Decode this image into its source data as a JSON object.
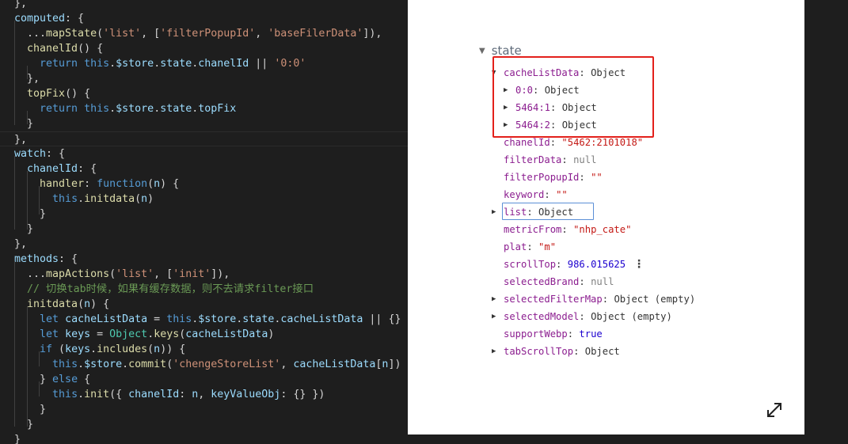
{
  "editor": {
    "lines": [
      [
        [
          "t-pl",
          "},"
        ]
      ],
      [
        [
          "t-var",
          "computed"
        ],
        [
          "t-pl",
          ": {"
        ]
      ],
      [
        [
          "t-pl",
          "  ..."
        ],
        [
          "t-fn",
          "mapState"
        ],
        [
          "t-pl",
          "("
        ],
        [
          "t-str",
          "'list'"
        ],
        [
          "t-pl",
          ", ["
        ],
        [
          "t-str",
          "'filterPopupId'"
        ],
        [
          "t-pl",
          ", "
        ],
        [
          "t-str",
          "'baseFilerData'"
        ],
        [
          "t-pl",
          "]),"
        ]
      ],
      [
        [
          "t-pl",
          "  "
        ],
        [
          "t-fn",
          "chanelId"
        ],
        [
          "t-pl",
          "() {"
        ]
      ],
      [
        [
          "t-pl",
          "    "
        ],
        [
          "t-kw",
          "return"
        ],
        [
          "t-pl",
          " "
        ],
        [
          "t-kw",
          "this"
        ],
        [
          "t-pl",
          "."
        ],
        [
          "t-var",
          "$store"
        ],
        [
          "t-pl",
          "."
        ],
        [
          "t-var",
          "state"
        ],
        [
          "t-pl",
          "."
        ],
        [
          "t-var",
          "chanelId"
        ],
        [
          "t-pl",
          " || "
        ],
        [
          "t-str",
          "'0:0'"
        ]
      ],
      [
        [
          "t-pl",
          "  },"
        ]
      ],
      [
        [
          "t-pl",
          "  "
        ],
        [
          "t-fn",
          "topFix"
        ],
        [
          "t-pl",
          "() {"
        ]
      ],
      [
        [
          "t-pl",
          "    "
        ],
        [
          "t-kw",
          "return"
        ],
        [
          "t-pl",
          " "
        ],
        [
          "t-kw",
          "this"
        ],
        [
          "t-pl",
          "."
        ],
        [
          "t-var",
          "$store"
        ],
        [
          "t-pl",
          "."
        ],
        [
          "t-var",
          "state"
        ],
        [
          "t-pl",
          "."
        ],
        [
          "t-var",
          "topFix"
        ]
      ],
      [
        [
          "t-pl",
          "  }"
        ]
      ],
      [
        [
          "t-pl",
          "},"
        ]
      ],
      [
        [
          "t-var",
          "watch"
        ],
        [
          "t-pl",
          ": {"
        ]
      ],
      [
        [
          "t-pl",
          "  "
        ],
        [
          "t-var",
          "chanelId"
        ],
        [
          "t-pl",
          ": {"
        ]
      ],
      [
        [
          "t-pl",
          "    "
        ],
        [
          "t-fn",
          "handler"
        ],
        [
          "t-pl",
          ": "
        ],
        [
          "t-kw",
          "function"
        ],
        [
          "t-pl",
          "("
        ],
        [
          "t-var",
          "n"
        ],
        [
          "t-pl",
          ") {"
        ]
      ],
      [
        [
          "t-pl",
          "      "
        ],
        [
          "t-kw",
          "this"
        ],
        [
          "t-pl",
          "."
        ],
        [
          "t-fn",
          "initdata"
        ],
        [
          "t-pl",
          "("
        ],
        [
          "t-var",
          "n"
        ],
        [
          "t-pl",
          ")"
        ]
      ],
      [
        [
          "t-pl",
          "    }"
        ]
      ],
      [
        [
          "t-pl",
          "  }"
        ]
      ],
      [
        [
          "t-pl",
          "},"
        ]
      ],
      [
        [
          "t-var",
          "methods"
        ],
        [
          "t-pl",
          ": {"
        ]
      ],
      [
        [
          "t-pl",
          "  ..."
        ],
        [
          "t-fn",
          "mapActions"
        ],
        [
          "t-pl",
          "("
        ],
        [
          "t-str",
          "'list'"
        ],
        [
          "t-pl",
          ", ["
        ],
        [
          "t-str",
          "'init'"
        ],
        [
          "t-pl",
          "]),"
        ]
      ],
      [
        [
          "t-cmt",
          "  // 切换tab时候，如果有缓存数据，则不去请求filter接口"
        ]
      ],
      [
        [
          "t-pl",
          "  "
        ],
        [
          "t-fn",
          "initdata"
        ],
        [
          "t-pl",
          "("
        ],
        [
          "t-var",
          "n"
        ],
        [
          "t-pl",
          ") {"
        ]
      ],
      [
        [
          "t-pl",
          "    "
        ],
        [
          "t-kw",
          "let"
        ],
        [
          "t-pl",
          " "
        ],
        [
          "t-var",
          "cacheListData"
        ],
        [
          "t-pl",
          " = "
        ],
        [
          "t-kw",
          "this"
        ],
        [
          "t-pl",
          "."
        ],
        [
          "t-var",
          "$store"
        ],
        [
          "t-pl",
          "."
        ],
        [
          "t-var",
          "state"
        ],
        [
          "t-pl",
          "."
        ],
        [
          "t-var",
          "cacheListData"
        ],
        [
          "t-pl",
          " || {}"
        ]
      ],
      [
        [
          "t-pl",
          "    "
        ],
        [
          "t-kw",
          "let"
        ],
        [
          "t-pl",
          " "
        ],
        [
          "t-var",
          "keys"
        ],
        [
          "t-pl",
          " = "
        ],
        [
          "t-cls",
          "Object"
        ],
        [
          "t-pl",
          "."
        ],
        [
          "t-fn",
          "keys"
        ],
        [
          "t-pl",
          "("
        ],
        [
          "t-var",
          "cacheListData"
        ],
        [
          "t-pl",
          ")"
        ]
      ],
      [
        [
          "t-pl",
          "    "
        ],
        [
          "t-kw",
          "if"
        ],
        [
          "t-pl",
          " ("
        ],
        [
          "t-var",
          "keys"
        ],
        [
          "t-pl",
          "."
        ],
        [
          "t-fn",
          "includes"
        ],
        [
          "t-pl",
          "("
        ],
        [
          "t-var",
          "n"
        ],
        [
          "t-pl",
          ")) {"
        ]
      ],
      [
        [
          "t-pl",
          "      "
        ],
        [
          "t-kw",
          "this"
        ],
        [
          "t-pl",
          "."
        ],
        [
          "t-var",
          "$store"
        ],
        [
          "t-pl",
          "."
        ],
        [
          "t-fn",
          "commit"
        ],
        [
          "t-pl",
          "("
        ],
        [
          "t-str",
          "'chengeStoreList'"
        ],
        [
          "t-pl",
          ", "
        ],
        [
          "t-var",
          "cacheListData"
        ],
        [
          "t-pl",
          "["
        ],
        [
          "t-var",
          "n"
        ],
        [
          "t-pl",
          "])"
        ]
      ],
      [
        [
          "t-pl",
          "    } "
        ],
        [
          "t-kw",
          "else"
        ],
        [
          "t-pl",
          " {"
        ]
      ],
      [
        [
          "t-pl",
          "      "
        ],
        [
          "t-kw",
          "this"
        ],
        [
          "t-pl",
          "."
        ],
        [
          "t-fn",
          "init"
        ],
        [
          "t-pl",
          "({ "
        ],
        [
          "t-var",
          "chanelId"
        ],
        [
          "t-pl",
          ": "
        ],
        [
          "t-var",
          "n"
        ],
        [
          "t-pl",
          ", "
        ],
        [
          "t-var",
          "keyValueObj"
        ],
        [
          "t-pl",
          ": {} })"
        ]
      ],
      [
        [
          "t-pl",
          "    }"
        ]
      ],
      [
        [
          "t-pl",
          "  }"
        ]
      ],
      [
        [
          "t-pl",
          "}"
        ]
      ]
    ]
  },
  "devtools": {
    "state_label": "state",
    "collapse_glyph": "▼",
    "expand_glyph": "▶",
    "props": [
      {
        "key": "cacheListData",
        "sep": ": ",
        "val": "Object",
        "vcls": "pl",
        "tri": "open",
        "indent": 0
      },
      {
        "key": "0:0",
        "sep": ": ",
        "val": "Object",
        "vcls": "pl",
        "tri": "closed",
        "indent": 1
      },
      {
        "key": "5464:1",
        "sep": ": ",
        "val": "Object",
        "vcls": "pl",
        "tri": "closed",
        "indent": 1
      },
      {
        "key": "5464:2",
        "sep": ": ",
        "val": "Object",
        "vcls": "pl",
        "tri": "closed",
        "indent": 1
      },
      {
        "key": "chanelId",
        "sep": ": ",
        "val": "\"5462:2101018\"",
        "vcls": "s",
        "tri": "none",
        "indent": 0
      },
      {
        "key": "filterData",
        "sep": ": ",
        "val": "null",
        "vcls": "nl",
        "tri": "none",
        "indent": 0
      },
      {
        "key": "filterPopupId",
        "sep": ": ",
        "val": "\"\"",
        "vcls": "s",
        "tri": "none",
        "indent": 0
      },
      {
        "key": "keyword",
        "sep": ": ",
        "val": "\"\"",
        "vcls": "s",
        "tri": "none",
        "indent": 0
      },
      {
        "key": "list",
        "sep": ": ",
        "val": "Object",
        "vcls": "pl",
        "tri": "closed",
        "indent": 0
      },
      {
        "key": "metricFrom",
        "sep": ": ",
        "val": "\"nhp_cate\"",
        "vcls": "s",
        "tri": "none",
        "indent": 0
      },
      {
        "key": "plat",
        "sep": ": ",
        "val": "\"m\"",
        "vcls": "s",
        "tri": "none",
        "indent": 0
      },
      {
        "key": "scrollTop",
        "sep": ": ",
        "val": "986.015625",
        "vcls": "n",
        "tri": "none",
        "indent": 0
      },
      {
        "key": "selectedBrand",
        "sep": ": ",
        "val": "null",
        "vcls": "nl",
        "tri": "none",
        "indent": 0
      },
      {
        "key": "selectedFilterMap",
        "sep": ": ",
        "val": "Object (empty)",
        "vcls": "pl",
        "tri": "closed",
        "indent": 0
      },
      {
        "key": "selectedModel",
        "sep": ": ",
        "val": "Object (empty)",
        "vcls": "pl",
        "tri": "closed",
        "indent": 0
      },
      {
        "key": "supportWebp",
        "sep": ": ",
        "val": "true",
        "vcls": "b",
        "tri": "none",
        "indent": 0
      },
      {
        "key": "tabScrollTop",
        "sep": ": ",
        "val": "Object",
        "vcls": "pl",
        "tri": "closed",
        "indent": 0
      }
    ],
    "kebab_glyph": "⋮"
  },
  "colors": {
    "editor_bg": "#1e1e1e",
    "panel_bg": "#ffffff",
    "highlight_box": "#e3201b",
    "focus_box": "#5b8fd6"
  },
  "icons": [
    "collapse-triangle-icon",
    "expand-triangle-icon",
    "kebab-menu-icon",
    "expand-arrows-icon"
  ]
}
